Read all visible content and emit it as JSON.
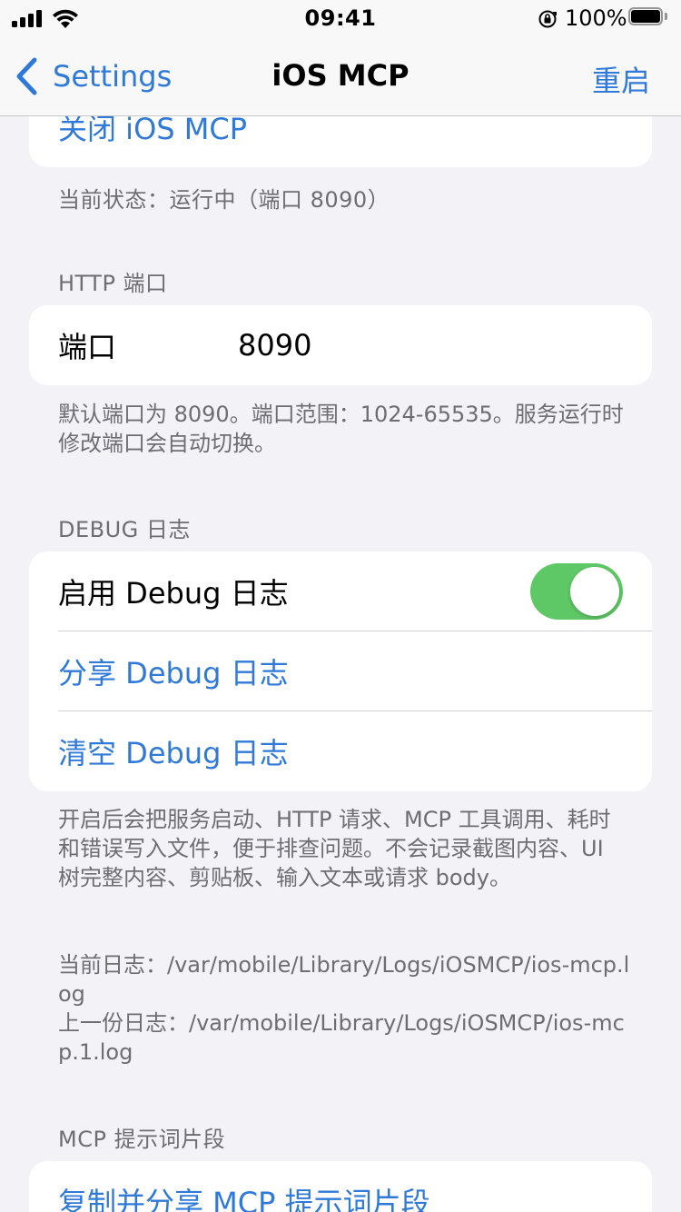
{
  "status_bar": {
    "time": "09:41",
    "battery_percent": "100%",
    "icons": [
      "signal-icon",
      "wifi-icon",
      "orientation-lock-icon",
      "battery-icon"
    ]
  },
  "nav": {
    "back_label": "Settings",
    "title": "iOS MCP",
    "restart_label": "重启"
  },
  "service": {
    "stop_label": "关闭 iOS MCP",
    "status_text": "当前状态：运行中（端口 8090）"
  },
  "http_port": {
    "header": "HTTP 端口",
    "label": "端口",
    "value": "8090",
    "footer": "默认端口为 8090。端口范围：1024-65535。服务运行时修改端口会自动切换。"
  },
  "debug_log": {
    "header": "DEBUG 日志",
    "enable_label": "启用 Debug 日志",
    "enabled": true,
    "share_label": "分享 Debug 日志",
    "clear_label": "清空 Debug 日志",
    "footer_desc": "开启后会把服务启动、HTTP 请求、MCP 工具调用、耗时和错误写入文件，便于排查问题。不会记录截图内容、UI 树完整内容、剪贴板、输入文本或请求 body。",
    "footer_paths": "当前日志：/var/mobile/Library/Logs/iOSMCP/ios-mcp.log\n上一份日志：/var/mobile/Library/Logs/iOSMCP/ios-mcp.1.log"
  },
  "prompt_snippet": {
    "header": "MCP 提示词片段",
    "copy_share_label": "复制并分享 MCP 提示词片段"
  },
  "colors": {
    "accent": "#2f7ad8",
    "toggle_on": "#5fc866",
    "background": "#f2f2f7",
    "secondary_text": "#6d6d72"
  }
}
